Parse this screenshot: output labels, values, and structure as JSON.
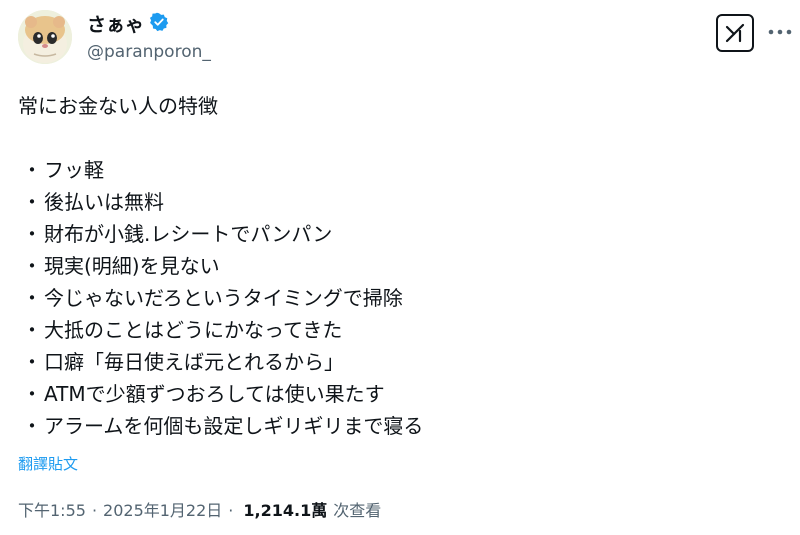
{
  "author": {
    "display_name": "さぁゃ",
    "handle": "@paranporon_",
    "verified": true,
    "verified_color": "#1d9bf0"
  },
  "header_icons": {
    "xai": "grok-icon",
    "more": "more-icon"
  },
  "tweet": {
    "title": "常にお金ない人の特徴",
    "bullet": "・",
    "items": [
      "フッ軽",
      "後払いは無料",
      "財布が小銭.レシートでパンパン",
      "現実(明細)を見ない",
      "今じゃないだろというタイミングで掃除",
      "大抵のことはどうにかなってきた",
      "口癖「毎日使えば元とれるから」",
      "ATMで少額ずつおろしては使い果たす",
      "アラームを何個も設定しギリギリまで寝る"
    ]
  },
  "translate_label": "翻譯貼文",
  "meta": {
    "time": "下午1:55",
    "separator": "·",
    "date": "2025年1月22日",
    "views_count": "1,214.1萬",
    "views_label": "次查看"
  },
  "colors": {
    "text": "#0f1419",
    "secondary": "#536471",
    "link": "#1d9bf0"
  }
}
